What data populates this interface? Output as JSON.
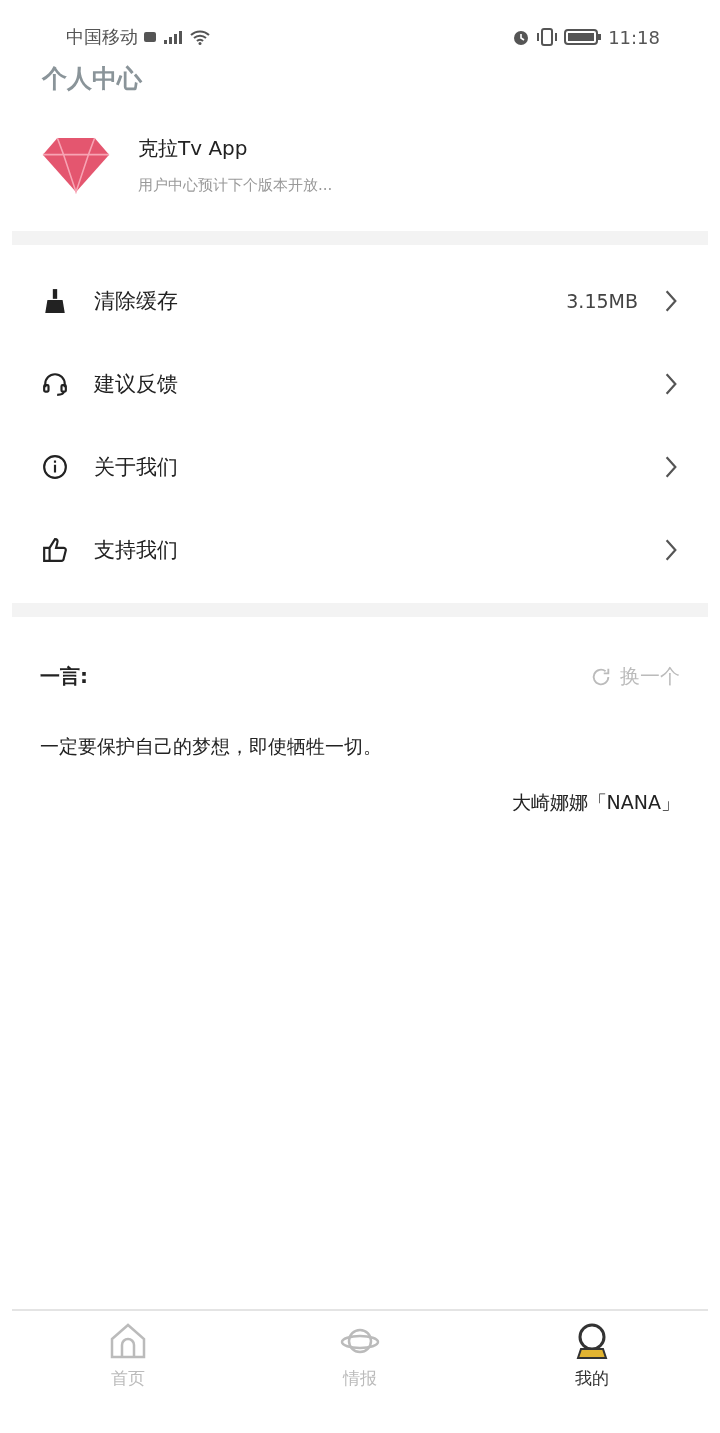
{
  "status_bar": {
    "carrier": "中国移动",
    "time": "11:18"
  },
  "header": {
    "title": "个人中心"
  },
  "profile": {
    "name": "克拉Tv App",
    "subtitle": "用户中心预计下个版本开放..."
  },
  "menu": [
    {
      "kind": "broom",
      "label": "清除缓存",
      "value": "3.15MB"
    },
    {
      "kind": "headset",
      "label": "建议反馈"
    },
    {
      "kind": "info",
      "label": "关于我们"
    },
    {
      "kind": "thumb",
      "label": "支持我们"
    }
  ],
  "quote": {
    "heading": "一言:",
    "refresh": "换一个",
    "text": "一定要保护自己的梦想，即使牺牲一切。",
    "author": "大崎娜娜「NANA」"
  },
  "tabs": [
    {
      "kind": "home",
      "label": "首页",
      "selected": false
    },
    {
      "kind": "planet",
      "label": "情报",
      "selected": false
    },
    {
      "kind": "ball",
      "label": "我的",
      "selected": true
    }
  ]
}
